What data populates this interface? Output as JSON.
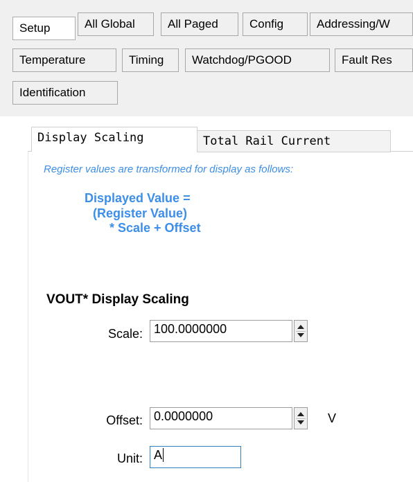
{
  "tabs_row1": [
    {
      "label": "Setup"
    },
    {
      "label": "All Global"
    },
    {
      "label": "All Paged"
    },
    {
      "label": "Config"
    },
    {
      "label": "Addressing/W"
    }
  ],
  "tabs_row2": [
    {
      "label": "Temperature"
    },
    {
      "label": "Timing"
    },
    {
      "label": "Watchdog/PGOOD"
    },
    {
      "label": "Fault Res"
    }
  ],
  "tabs_row3": [
    {
      "label": "Identification"
    }
  ],
  "subtabs": [
    {
      "label": "Display Scaling"
    },
    {
      "label": "Total Rail Current"
    }
  ],
  "info_text": "Register values are transformed for display as follows:",
  "formula": {
    "line1": "Displayed Value =",
    "line2": "(Register Value)",
    "line3": "* Scale + Offset"
  },
  "section_title": "VOUT* Display Scaling",
  "scale": {
    "label": "Scale:",
    "value": "100.0000000"
  },
  "offset": {
    "label": "Offset:",
    "value": "0.0000000",
    "unit": "V"
  },
  "unit": {
    "label": "Unit:",
    "value": "A"
  },
  "colors": {
    "accent_text": "#3c8ee8",
    "tab_bg": "#f0f0f0"
  }
}
